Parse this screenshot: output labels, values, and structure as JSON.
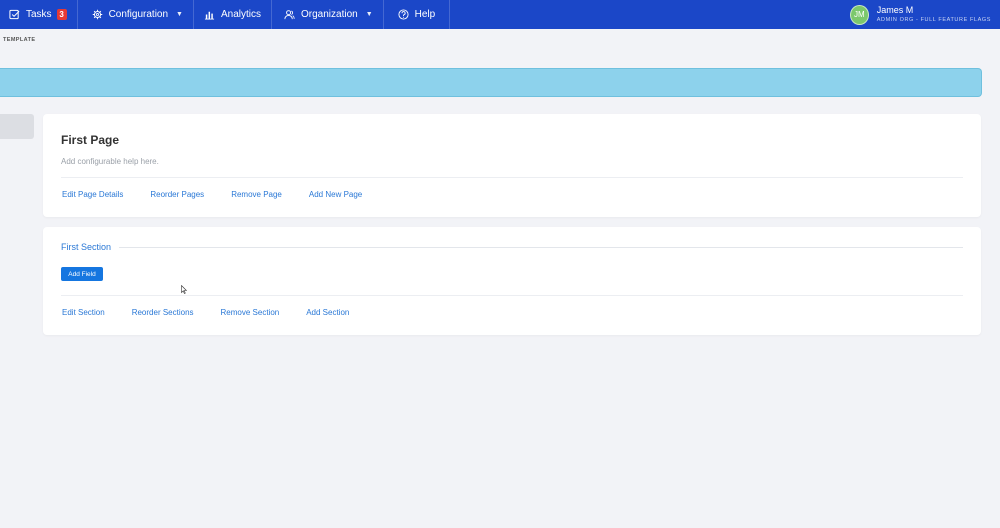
{
  "nav": {
    "items": [
      {
        "label": "Tasks",
        "icon": "checkbox-icon",
        "badge": "3"
      },
      {
        "label": "Configuration",
        "icon": "gear-icon",
        "dropdown": true
      },
      {
        "label": "Analytics",
        "icon": "bar-chart-icon"
      },
      {
        "label": "Organization",
        "icon": "people-icon",
        "dropdown": true
      },
      {
        "label": "Help",
        "icon": "question-circle-icon"
      }
    ],
    "user": {
      "initials": "JM",
      "name": "James M",
      "subtitle": "ADMIN ORG - FULL FEATURE FLAGS"
    }
  },
  "breadcrumb": "TEMPLATE",
  "page_card": {
    "title": "First Page",
    "help": "Add configurable help here.",
    "links": [
      "Edit Page Details",
      "Reorder Pages",
      "Remove Page",
      "Add New Page"
    ]
  },
  "section_card": {
    "title": "First Section",
    "add_field_label": "Add Field",
    "links": [
      "Edit Section",
      "Reorder Sections",
      "Remove Section",
      "Add Section"
    ]
  },
  "colors": {
    "nav_bg": "#1b47c8",
    "info_bar": "#8dd2ec",
    "link": "#2a78d6",
    "primary_button": "#1576e0",
    "badge": "#e53935",
    "avatar": "#7cc86c"
  }
}
